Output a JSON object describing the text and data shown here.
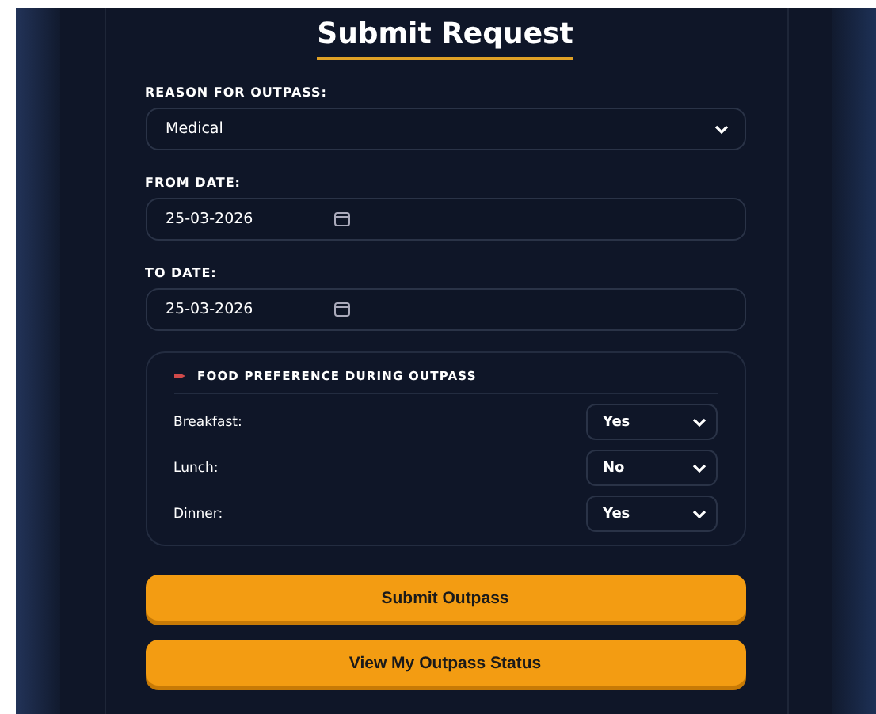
{
  "title": "Submit Request",
  "reason": {
    "label": "REASON FOR OUTPASS:",
    "value": "Medical"
  },
  "from_date": {
    "label": "FROM DATE:",
    "value": "25-03-2026"
  },
  "to_date": {
    "label": "TO DATE:",
    "value": "25-03-2026"
  },
  "food": {
    "heading": "FOOD PREFERENCE DURING OUTPASS",
    "meals": [
      {
        "label": "Breakfast:",
        "value": "Yes"
      },
      {
        "label": "Lunch:",
        "value": "No"
      },
      {
        "label": "Dinner:",
        "value": "Yes"
      }
    ]
  },
  "buttons": [
    "Submit Outpass",
    "View My Outpass Status"
  ]
}
